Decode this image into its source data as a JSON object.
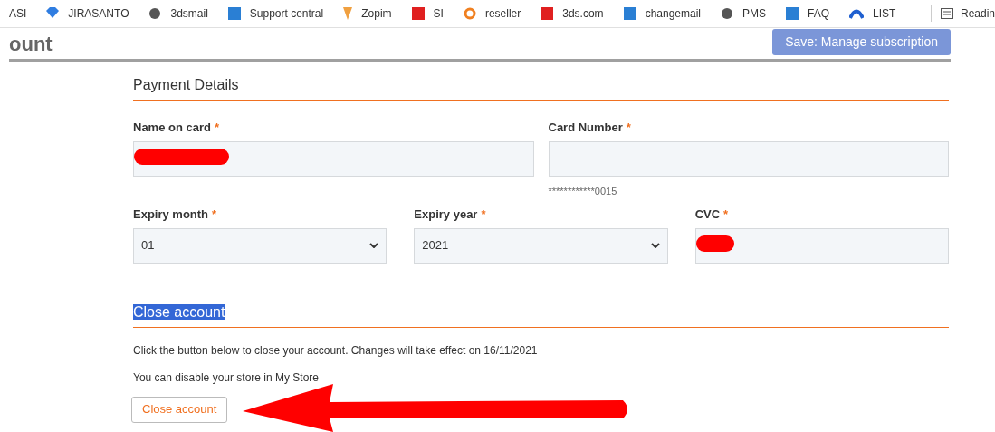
{
  "bookmarks": [
    {
      "label": "ASI"
    },
    {
      "label": "JIRASANTO"
    },
    {
      "label": "3dsmail"
    },
    {
      "label": "Support central"
    },
    {
      "label": "Zopim"
    },
    {
      "label": "SI"
    },
    {
      "label": "reseller"
    },
    {
      "label": "3ds.com"
    },
    {
      "label": "changemail"
    },
    {
      "label": "PMS"
    },
    {
      "label": "FAQ"
    },
    {
      "label": "LIST"
    }
  ],
  "reading_list": {
    "label": "Readin"
  },
  "header": {
    "title": "ount",
    "save_button": "Save: Manage subscription"
  },
  "payment": {
    "heading": "Payment Details",
    "fields": [
      {
        "label": "Name on card",
        "required": "*",
        "kind": "text",
        "redacted": true
      },
      {
        "label": "Card Number",
        "required": "*",
        "kind": "text",
        "hint": "************0015"
      }
    ],
    "fields_row2": [
      {
        "label": "Expiry month",
        "required": "*",
        "kind": "select",
        "value": "01"
      },
      {
        "label": "Expiry year",
        "required": "*",
        "kind": "select",
        "value": "2021"
      },
      {
        "label": "CVC",
        "required": "*",
        "kind": "text",
        "redacted": true
      }
    ]
  },
  "close": {
    "heading": "Close account",
    "heading_highlighted": true,
    "text": "Click the button below to close your account. Changes will take effect on 16/11/2021",
    "note": "You can disable your store in My Store",
    "button": "Close account"
  }
}
